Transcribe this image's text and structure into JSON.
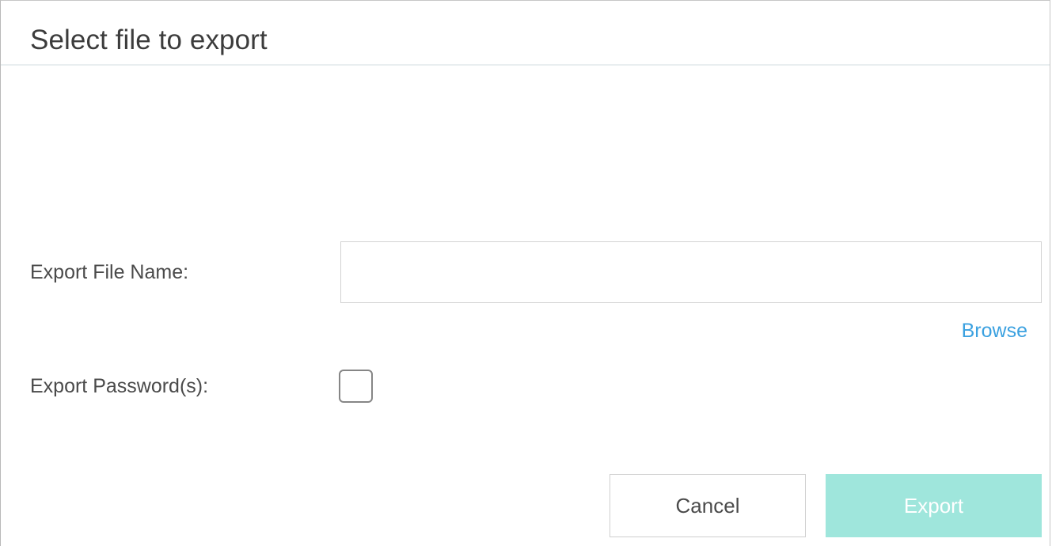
{
  "dialog": {
    "title": "Select file to export"
  },
  "form": {
    "filename_label": "Export File Name:",
    "filename_value": "",
    "filename_placeholder": "",
    "browse_label": "Browse",
    "password_label": "Export Password(s):",
    "password_checked": false
  },
  "actions": {
    "cancel_label": "Cancel",
    "export_label": "Export",
    "export_enabled": false
  },
  "colors": {
    "link": "#3ba1e0",
    "export_button_disabled": "#9fe6dc"
  }
}
